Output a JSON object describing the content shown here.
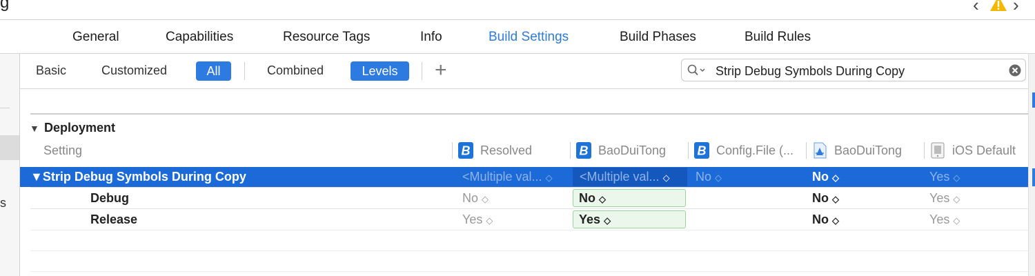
{
  "window": {
    "title_fragment": "g"
  },
  "colors": {
    "accent": "#2d7be0",
    "selection": "#1c6ad8",
    "green_cell": "#eaf7ea",
    "warning": "#f5b800"
  },
  "nav": {
    "back": "‹",
    "forward": "›",
    "warning_icon": "warning-triangle-icon"
  },
  "tabs": [
    {
      "label": "General"
    },
    {
      "label": "Capabilities"
    },
    {
      "label": "Resource Tags"
    },
    {
      "label": "Info"
    },
    {
      "label": "Build Settings",
      "active": true
    },
    {
      "label": "Build Phases"
    },
    {
      "label": "Build Rules"
    }
  ],
  "sidebar": {
    "partial_text": "s"
  },
  "filters": {
    "basic": "Basic",
    "customized": "Customized",
    "all": "All",
    "combined": "Combined",
    "levels": "Levels",
    "add": "+",
    "selected_scope": "All",
    "selected_view": "Levels"
  },
  "search": {
    "value": "Strip Debug Symbols During Copy"
  },
  "section": {
    "title": "Deployment",
    "setting_header": "Setting",
    "columns": [
      {
        "label": "Resolved",
        "icon": "build-settings-icon"
      },
      {
        "label": "BaoDuiTong",
        "icon": "build-settings-icon"
      },
      {
        "label": "Config.File (...",
        "icon": "build-settings-icon"
      },
      {
        "label": "BaoDuiTong",
        "icon": "project-file-icon"
      },
      {
        "label": "iOS Default",
        "icon": "sdk-default-icon"
      }
    ]
  },
  "setting": {
    "name": "Strip Debug Symbols During Copy",
    "values": [
      "<Multiple val...",
      "<Multiple val...",
      "No",
      "No",
      "Yes"
    ]
  },
  "rows": [
    {
      "label": "Debug",
      "resolved": "No",
      "target": "No",
      "project": "No",
      "default": "Yes"
    },
    {
      "label": "Release",
      "resolved": "Yes",
      "target": "Yes",
      "project": "No",
      "default": "Yes"
    }
  ]
}
